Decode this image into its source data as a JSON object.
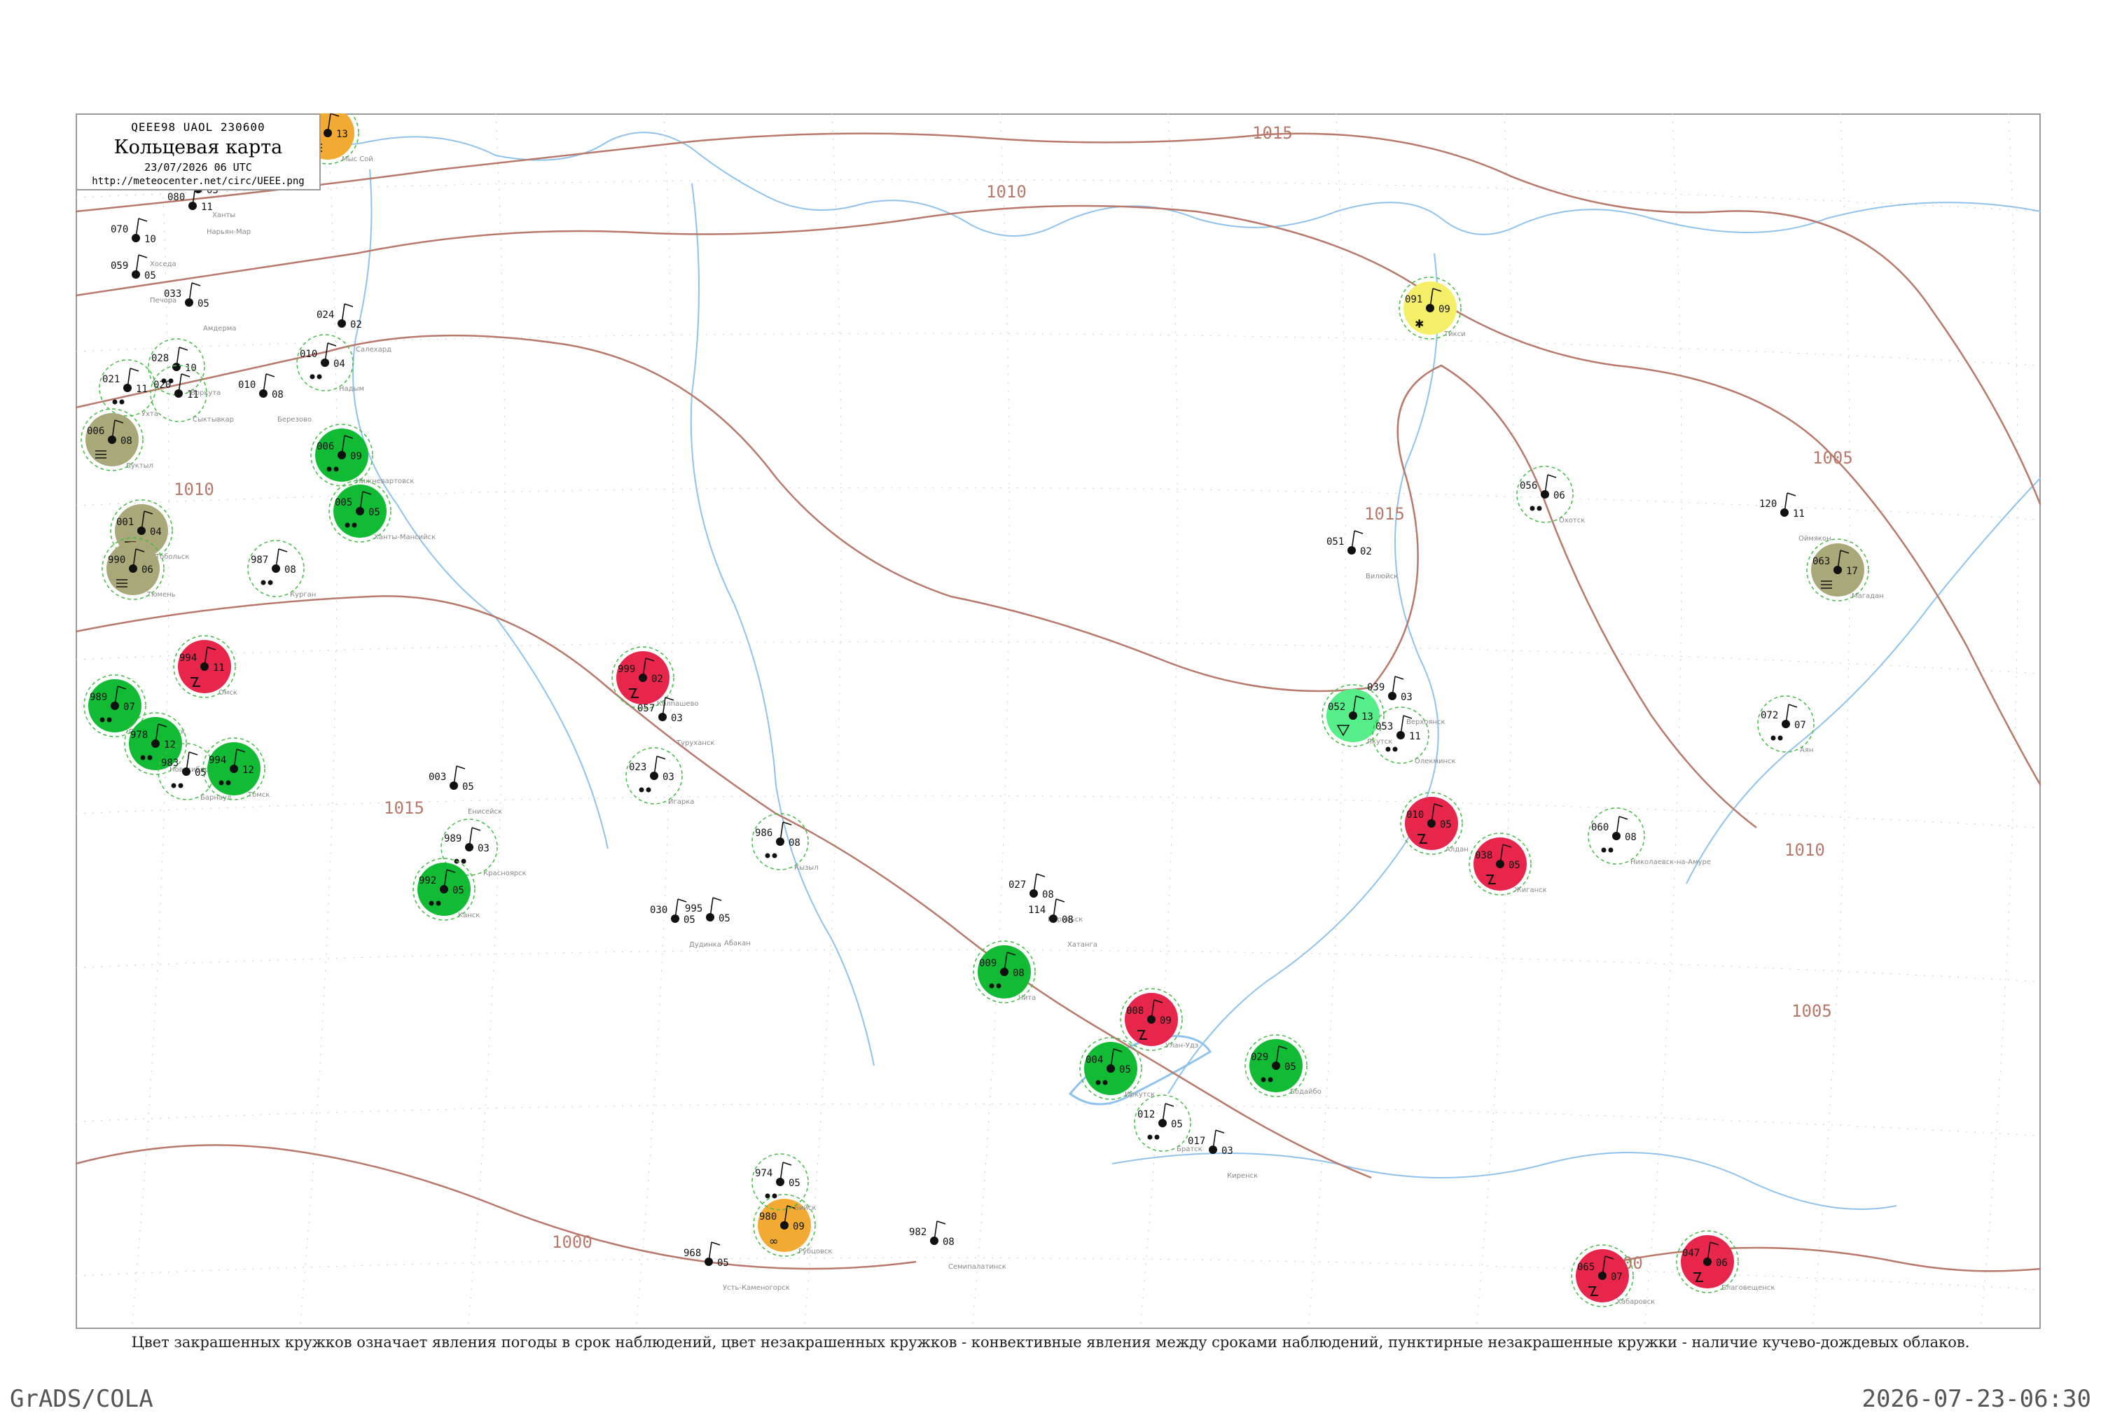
{
  "header": {
    "code_line": "QEEE98  UAOL  230600",
    "title": "Кольцевая карта",
    "datetime": "23/07/2026 06 UTC",
    "url": "http://meteocenter.net/circ/UEEE.png"
  },
  "caption": "Цвет закрашенных кружков означает явления погоды в срок наблюдений, цвет незакрашенных кружков - конвективные явления между сроками наблюдений, пунктирные незакрашенные кружки - наличие кучево-дождевых облаков.",
  "footer": {
    "left": "GrADS/COLA",
    "right": "2026-07-23-06:30"
  },
  "isobars": [
    {
      "label": "1015"
    },
    {
      "label": "1010"
    },
    {
      "label": "1005"
    },
    {
      "label": "1000"
    }
  ],
  "colors": {
    "frame": "#9a9a9a",
    "isobar": "#b8786a",
    "river": "#8fc3ee",
    "station_label": "#888888",
    "cb_dashed": "#44bb44",
    "rain_green": "#11bb33",
    "thunder_red": "#e8254a",
    "fog_olive": "#a8a878",
    "dust_orange": "#f2aa33",
    "snow_yellow": "#f4ef66",
    "shower_light": "#55ee88"
  },
  "stations": [
    {
      "id": "s001",
      "name": "Мыс Сой",
      "pressure": "098",
      "temp": "13",
      "wx": "fog",
      "circle": "orange"
    },
    {
      "id": "s002",
      "name": "Ханты",
      "pressure": "068",
      "temp": "03",
      "wx": "",
      "circle": ""
    },
    {
      "id": "s003",
      "name": "Нарьян-Мар",
      "pressure": "080",
      "temp": "11",
      "wx": "",
      "circle": ""
    },
    {
      "id": "s004",
      "name": "Хоседа",
      "pressure": "070",
      "temp": "10",
      "wx": "",
      "circle": ""
    },
    {
      "id": "s005",
      "name": "Печора",
      "pressure": "059",
      "temp": "05",
      "wx": "",
      "circle": ""
    },
    {
      "id": "s006",
      "name": "Амдерма",
      "pressure": "033",
      "temp": "05",
      "wx": "",
      "circle": ""
    },
    {
      "id": "s007",
      "name": "Воркута",
      "pressure": "028",
      "temp": "10",
      "wx": "rain",
      "circle": "cb"
    },
    {
      "id": "s008",
      "name": "Сыктывкар",
      "pressure": "020",
      "temp": "11",
      "wx": "",
      "circle": "cb"
    },
    {
      "id": "s009",
      "name": "Ухта",
      "pressure": "021",
      "temp": "11",
      "wx": "rain",
      "circle": "cb"
    },
    {
      "id": "s010",
      "name": "Вуктыл",
      "pressure": "006",
      "temp": "08",
      "wx": "fog",
      "circle": "olive"
    },
    {
      "id": "s011",
      "name": "Березово",
      "pressure": "010",
      "temp": "08",
      "wx": "",
      "circle": ""
    },
    {
      "id": "s012",
      "name": "Салехард",
      "pressure": "024",
      "temp": "02",
      "wx": "",
      "circle": ""
    },
    {
      "id": "s013",
      "name": "Надым",
      "pressure": "010",
      "temp": "04",
      "wx": "rain",
      "circle": "cb"
    },
    {
      "id": "s014",
      "name": "Нижневартовск",
      "pressure": "006",
      "temp": "09",
      "wx": "rain",
      "circle": "green"
    },
    {
      "id": "s015",
      "name": "Ханты-Мансийск",
      "pressure": "005",
      "temp": "05",
      "wx": "rain",
      "circle": "green"
    },
    {
      "id": "s016",
      "name": "Тобольск",
      "pressure": "001",
      "temp": "04",
      "wx": "fog",
      "circle": "olive"
    },
    {
      "id": "s017",
      "name": "Тюмень",
      "pressure": "990",
      "temp": "06",
      "wx": "fog",
      "circle": "olive"
    },
    {
      "id": "s018",
      "name": "Курган",
      "pressure": "987",
      "temp": "08",
      "wx": "rain",
      "circle": "cb"
    },
    {
      "id": "s019",
      "name": "Омск",
      "pressure": "994",
      "temp": "11",
      "wx": "thunder",
      "circle": "red"
    },
    {
      "id": "s020",
      "name": "Петропавловск",
      "pressure": "989",
      "temp": "07",
      "wx": "rain",
      "circle": "green"
    },
    {
      "id": "s021",
      "name": "Новосибирск",
      "pressure": "978",
      "temp": "12",
      "wx": "rain",
      "circle": "green"
    },
    {
      "id": "s022",
      "name": "Барнаул",
      "pressure": "983",
      "temp": "05",
      "wx": "rain",
      "circle": "cb"
    },
    {
      "id": "s023",
      "name": "Томск",
      "pressure": "994",
      "temp": "12",
      "wx": "rain",
      "circle": "green"
    },
    {
      "id": "s024",
      "name": "Колпашево",
      "pressure": "999",
      "temp": "02",
      "wx": "thunder",
      "circle": "red"
    },
    {
      "id": "s025",
      "name": "Красноярск",
      "pressure": "989",
      "temp": "03",
      "wx": "rain",
      "circle": "cb"
    },
    {
      "id": "s026",
      "name": "Канск",
      "pressure": "992",
      "temp": "05",
      "wx": "rain",
      "circle": "green"
    },
    {
      "id": "s027",
      "name": "Енисейск",
      "pressure": "003",
      "temp": "05",
      "wx": "",
      "circle": ""
    },
    {
      "id": "s028",
      "name": "Туруханск",
      "pressure": "057",
      "temp": "03",
      "wx": "",
      "circle": ""
    },
    {
      "id": "s029",
      "name": "Игарка",
      "pressure": "023",
      "temp": "03",
      "wx": "rain",
      "circle": "cb"
    },
    {
      "id": "s030",
      "name": "Дудинка",
      "pressure": "030",
      "temp": "05",
      "wx": "",
      "circle": ""
    },
    {
      "id": "s031",
      "name": "Норильск",
      "pressure": "027",
      "temp": "08",
      "wx": "",
      "circle": ""
    },
    {
      "id": "s032",
      "name": "Хатанга",
      "pressure": "114",
      "temp": "08",
      "wx": "",
      "circle": ""
    },
    {
      "id": "s033",
      "name": "Тикси",
      "pressure": "091",
      "temp": "09",
      "wx": "snow",
      "circle": "yellow"
    },
    {
      "id": "s034",
      "name": "Якутск",
      "pressure": "052",
      "temp": "13",
      "wx": "shower",
      "circle": "lightgreen"
    },
    {
      "id": "s035",
      "name": "Олекминск",
      "pressure": "053",
      "temp": "11",
      "wx": "rain",
      "circle": "cb"
    },
    {
      "id": "s036",
      "name": "Алдан",
      "pressure": "010",
      "temp": "05",
      "wx": "thunder",
      "circle": "red"
    },
    {
      "id": "s037",
      "name": "Вилюйск",
      "pressure": "051",
      "temp": "02",
      "wx": "",
      "circle": ""
    },
    {
      "id": "s038",
      "name": "Жиганск",
      "pressure": "038",
      "temp": "05",
      "wx": "thunder",
      "circle": "red"
    },
    {
      "id": "s039",
      "name": "Верхоянск",
      "pressure": "039",
      "temp": "03",
      "wx": "",
      "circle": ""
    },
    {
      "id": "s040",
      "name": "Оймякон",
      "pressure": "120",
      "temp": "11",
      "wx": "",
      "circle": ""
    },
    {
      "id": "s041",
      "name": "Магадан",
      "pressure": "063",
      "temp": "17",
      "wx": "fog",
      "circle": "olive"
    },
    {
      "id": "s042",
      "name": "Охотск",
      "pressure": "056",
      "temp": "06",
      "wx": "rain",
      "circle": "cb"
    },
    {
      "id": "s043",
      "name": "Аян",
      "pressure": "072",
      "temp": "07",
      "wx": "rain",
      "circle": "cb"
    },
    {
      "id": "s044",
      "name": "Николаевск-на-Амуре",
      "pressure": "060",
      "temp": "08",
      "wx": "rain",
      "circle": "cb"
    },
    {
      "id": "s045",
      "name": "Хабаровск",
      "pressure": "065",
      "temp": "07",
      "wx": "thunder",
      "circle": "red"
    },
    {
      "id": "s046",
      "name": "Благовещенск",
      "pressure": "047",
      "temp": "06",
      "wx": "thunder",
      "circle": "red"
    },
    {
      "id": "s047",
      "name": "Чита",
      "pressure": "009",
      "temp": "08",
      "wx": "rain",
      "circle": "green"
    },
    {
      "id": "s048",
      "name": "Улан-Удэ",
      "pressure": "008",
      "temp": "09",
      "wx": "thunder",
      "circle": "red"
    },
    {
      "id": "s049",
      "name": "Иркутск",
      "pressure": "004",
      "temp": "05",
      "wx": "rain",
      "circle": "green"
    },
    {
      "id": "s050",
      "name": "Братск",
      "pressure": "012",
      "temp": "05",
      "wx": "rain",
      "circle": "cb"
    },
    {
      "id": "s051",
      "name": "Киренск",
      "pressure": "017",
      "temp": "03",
      "wx": "",
      "circle": ""
    },
    {
      "id": "s052",
      "name": "Бодайбо",
      "pressure": "029",
      "temp": "05",
      "wx": "rain",
      "circle": "green"
    },
    {
      "id": "s053",
      "name": "Кызыл",
      "pressure": "986",
      "temp": "08",
      "wx": "rain",
      "circle": "cb"
    },
    {
      "id": "s054",
      "name": "Абакан",
      "pressure": "995",
      "temp": "05",
      "wx": "",
      "circle": ""
    },
    {
      "id": "s055",
      "name": "Рубцовск",
      "pressure": "980",
      "temp": "09",
      "wx": "dust",
      "circle": "orange"
    },
    {
      "id": "s056",
      "name": "Семипалатинск",
      "pressure": "982",
      "temp": "08",
      "wx": "",
      "circle": ""
    },
    {
      "id": "s057",
      "name": "Усть-Каменогорск",
      "pressure": "968",
      "temp": "05",
      "wx": "",
      "circle": ""
    },
    {
      "id": "s058",
      "name": "Бийск",
      "pressure": "974",
      "temp": "05",
      "wx": "rain",
      "circle": "cb"
    }
  ]
}
